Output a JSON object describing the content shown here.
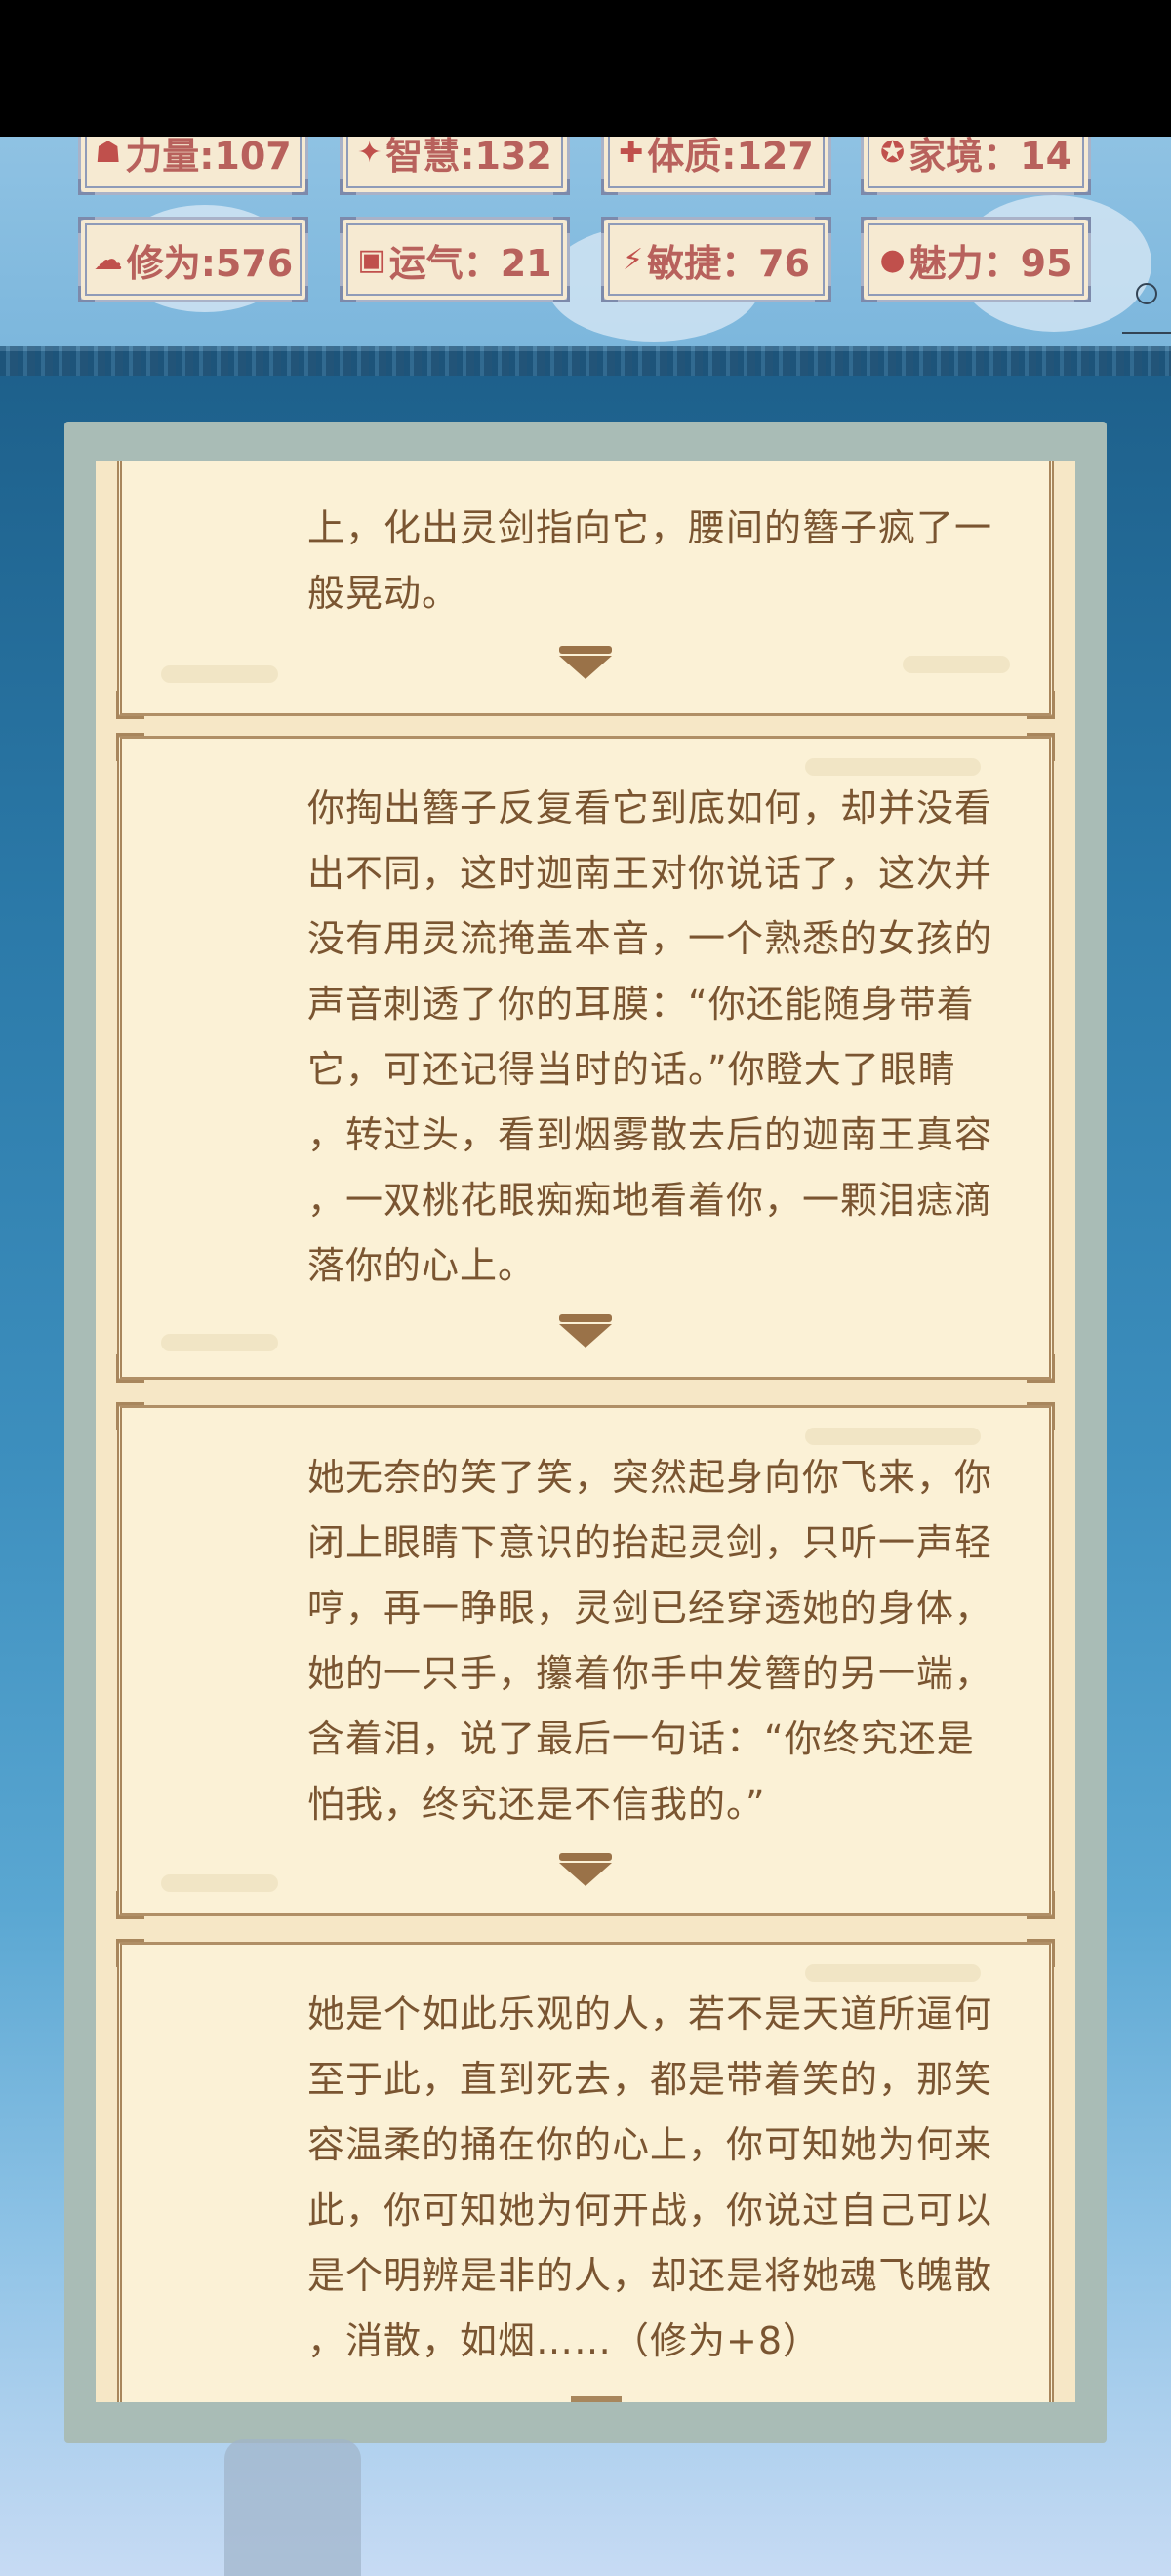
{
  "stats": {
    "row1": [
      {
        "icon_name": "strength-icon",
        "glyph": "☗",
        "label": "力量:107"
      },
      {
        "icon_name": "wisdom-icon",
        "glyph": "✦",
        "label": "智慧:132"
      },
      {
        "icon_name": "constitution-icon",
        "glyph": "✚",
        "label": "体质:127"
      },
      {
        "icon_name": "realm-icon",
        "glyph": "✪",
        "label": "家境：14"
      }
    ],
    "row2": [
      {
        "icon_name": "cultivation-icon",
        "glyph": "☁",
        "label": "修为:576"
      },
      {
        "icon_name": "luck-icon",
        "glyph": "▣",
        "label": "运气：21"
      },
      {
        "icon_name": "agility-icon",
        "glyph": "⚡",
        "label": "敏捷：76"
      },
      {
        "icon_name": "charm-icon",
        "glyph": "●",
        "label": "魅力：95"
      }
    ]
  },
  "story": [
    {
      "text": "上，化出灵剑指向它，腰间的簪子疯了一\n般晃动。"
    },
    {
      "text": "你掏出簪子反复看它到底如何，却并没看\n出不同，这时迦南王对你说话了，这次并\n没有用灵流掩盖本音，一个熟悉的女孩的\n声音刺透了你的耳膜：“你还能随身带着\n它，可还记得当时的话。”你瞪大了眼睛\n，转过头，看到烟雾散去后的迦南王真容\n，一双桃花眼痴痴地看着你，一颗泪痣滴\n落你的心上。"
    },
    {
      "text": "她无奈的笑了笑，突然起身向你飞来，你\n闭上眼睛下意识的抬起灵剑，只听一声轻\n哼，再一睁眼，灵剑已经穿透她的身体，\n她的一只手，攥着你手中发簪的另一端，\n含着泪，说了最后一句话：“你终究还是\n怕我，终究还是不信我的。”"
    },
    {
      "text": "她是个如此乐观的人，若不是天道所逼何\n至于此，直到死去，都是带着笑的，那笑\n容温柔的捅在你的心上，你可知她为何来\n此，你可知她为何开战，你说过自己可以\n是个明辨是非的人，却还是将她魂飞魄散\n，消散，如烟……（修为+8）"
    }
  ],
  "colors": {
    "stat_text": "#b8615c",
    "story_text": "#7a5531",
    "card_bg": "#fbf1d6",
    "panel_border": "#a9bcb6"
  }
}
